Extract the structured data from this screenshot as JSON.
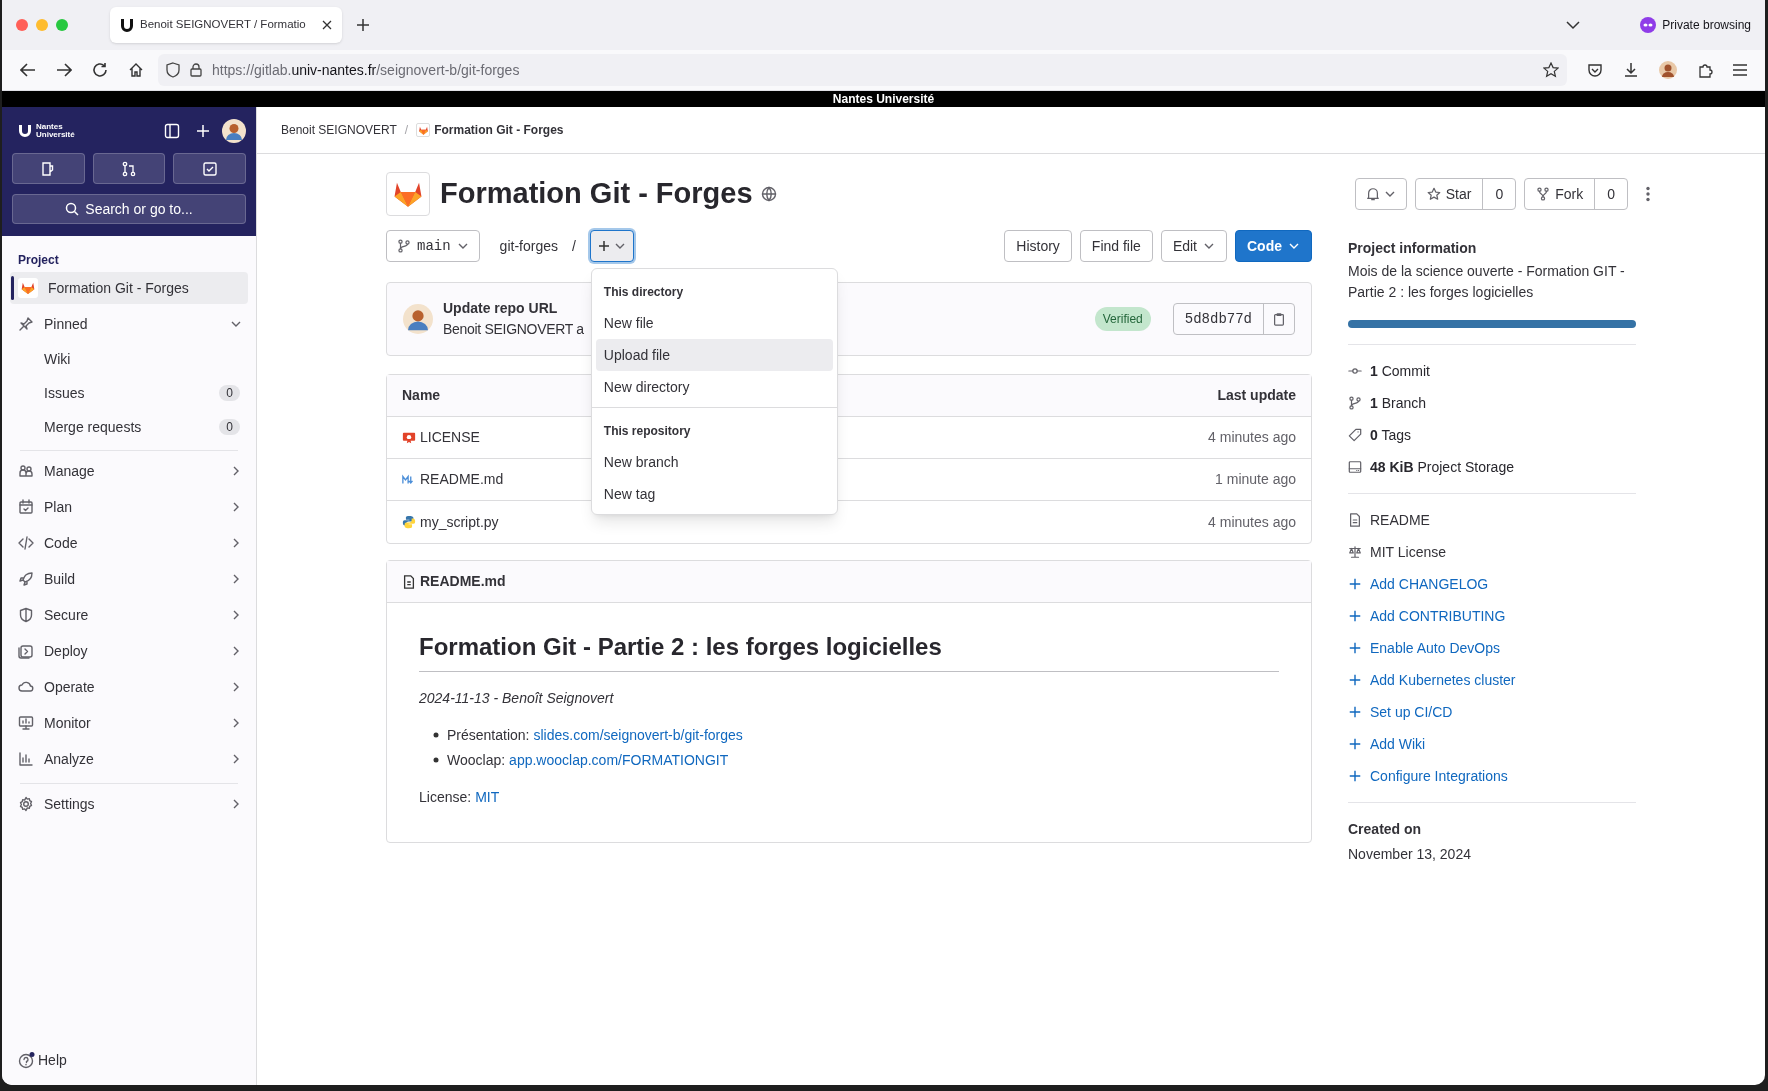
{
  "browser": {
    "tab_title": "Benoit SEIGNOVERT / Formatio",
    "url": {
      "scheme": "https://gitlab.",
      "host": "univ-nantes.fr",
      "path": "/seignovert-b/git-forges"
    },
    "private_label": "Private browsing"
  },
  "banner": "Nantes Université",
  "sidebar": {
    "logo": [
      "Nantes",
      "Université"
    ],
    "search": "Search or go to...",
    "section": "Project",
    "project": {
      "label": "Formation Git - Forges",
      "selected": true
    },
    "items": [
      {
        "label": "Pinned",
        "expanded": true,
        "children": [
          {
            "label": "Wiki"
          },
          {
            "label": "Issues",
            "count": "0"
          },
          {
            "label": "Merge requests",
            "count": "0"
          }
        ]
      },
      {
        "label": "Manage",
        "expanded": false
      },
      {
        "label": "Plan",
        "expanded": false
      },
      {
        "label": "Code",
        "expanded": false
      },
      {
        "label": "Build",
        "expanded": false
      },
      {
        "label": "Secure",
        "expanded": false
      },
      {
        "label": "Deploy",
        "expanded": false
      },
      {
        "label": "Operate",
        "expanded": false
      },
      {
        "label": "Monitor",
        "expanded": false
      },
      {
        "label": "Analyze",
        "expanded": false
      }
    ],
    "settings": {
      "label": "Settings",
      "expanded": false
    },
    "help": "Help"
  },
  "breadcrumb": [
    "Benoit SEIGNOVERT",
    "Formation Git - Forges"
  ],
  "breadcrumb_separator": "/",
  "project": {
    "title": "Formation Git - Forges",
    "star": {
      "label": "Star",
      "count": "0"
    },
    "fork": {
      "label": "Fork",
      "count": "0"
    }
  },
  "repo_bar": {
    "branch": "main",
    "path": "git-forges",
    "separator": "/",
    "buttons": [
      {
        "label": "History",
        "kind": "default"
      },
      {
        "label": "Find file",
        "kind": "default"
      },
      {
        "label": "Edit",
        "kind": "dropdown"
      },
      {
        "label": "Code",
        "kind": "primary"
      }
    ]
  },
  "add_menu": {
    "expanded": true,
    "sections": [
      {
        "heading": "This directory",
        "items": [
          {
            "label": "New file",
            "selected": false
          },
          {
            "label": "Upload file",
            "selected": true
          },
          {
            "label": "New directory",
            "selected": false
          }
        ]
      },
      {
        "heading": "This repository",
        "items": [
          {
            "label": "New branch",
            "selected": false
          },
          {
            "label": "New tag",
            "selected": false
          }
        ]
      }
    ]
  },
  "commit": {
    "title": "Update repo URL",
    "author": "Benoit SEIGNOVERT a",
    "badge": "Verified",
    "sha": "5d8db77d"
  },
  "files": {
    "columns": [
      "Name",
      "Last update"
    ],
    "rows": [
      {
        "name": "LICENSE",
        "kind": "license",
        "updated": "4 minutes ago"
      },
      {
        "name": "README.md",
        "kind": "markdown",
        "updated": "1 minute ago"
      },
      {
        "name": "my_script.py",
        "kind": "python",
        "updated": "4 minutes ago"
      }
    ]
  },
  "readme": {
    "filename": "README.md",
    "heading": "Formation Git - Partie 2 : les forges logicielles",
    "meta": "2024-11-13 - Benoît Seignovert",
    "list": [
      {
        "label": "Présentation:",
        "link": "slides.com/seignovert-b/git-forges"
      },
      {
        "label": "Wooclap:",
        "link": "app.wooclap.com/FORMATIONGIT"
      }
    ],
    "license": {
      "label": "License:",
      "link": "MIT"
    }
  },
  "project_info": {
    "title": "Project information",
    "description": "Mois de la science ouverte - Formation GIT - Partie 2 : les forges logicielles",
    "stats": [
      "**1** Commit",
      "**1** Branch",
      "**0** Tags",
      "**48 KiB** Project Storage"
    ],
    "links": [
      {
        "label": "README",
        "kind": "file"
      },
      {
        "label": "MIT License",
        "kind": "license"
      },
      {
        "label": "Add CHANGELOG",
        "kind": "add"
      },
      {
        "label": "Add CONTRIBUTING",
        "kind": "add"
      },
      {
        "label": "Enable Auto DevOps",
        "kind": "add"
      },
      {
        "label": "Add Kubernetes cluster",
        "kind": "add"
      },
      {
        "label": "Set up CI/CD",
        "kind": "add"
      },
      {
        "label": "Add Wiki",
        "kind": "add"
      },
      {
        "label": "Configure Integrations",
        "kind": "add"
      }
    ],
    "created_label": "Created on",
    "created": "November 13, 2024"
  }
}
